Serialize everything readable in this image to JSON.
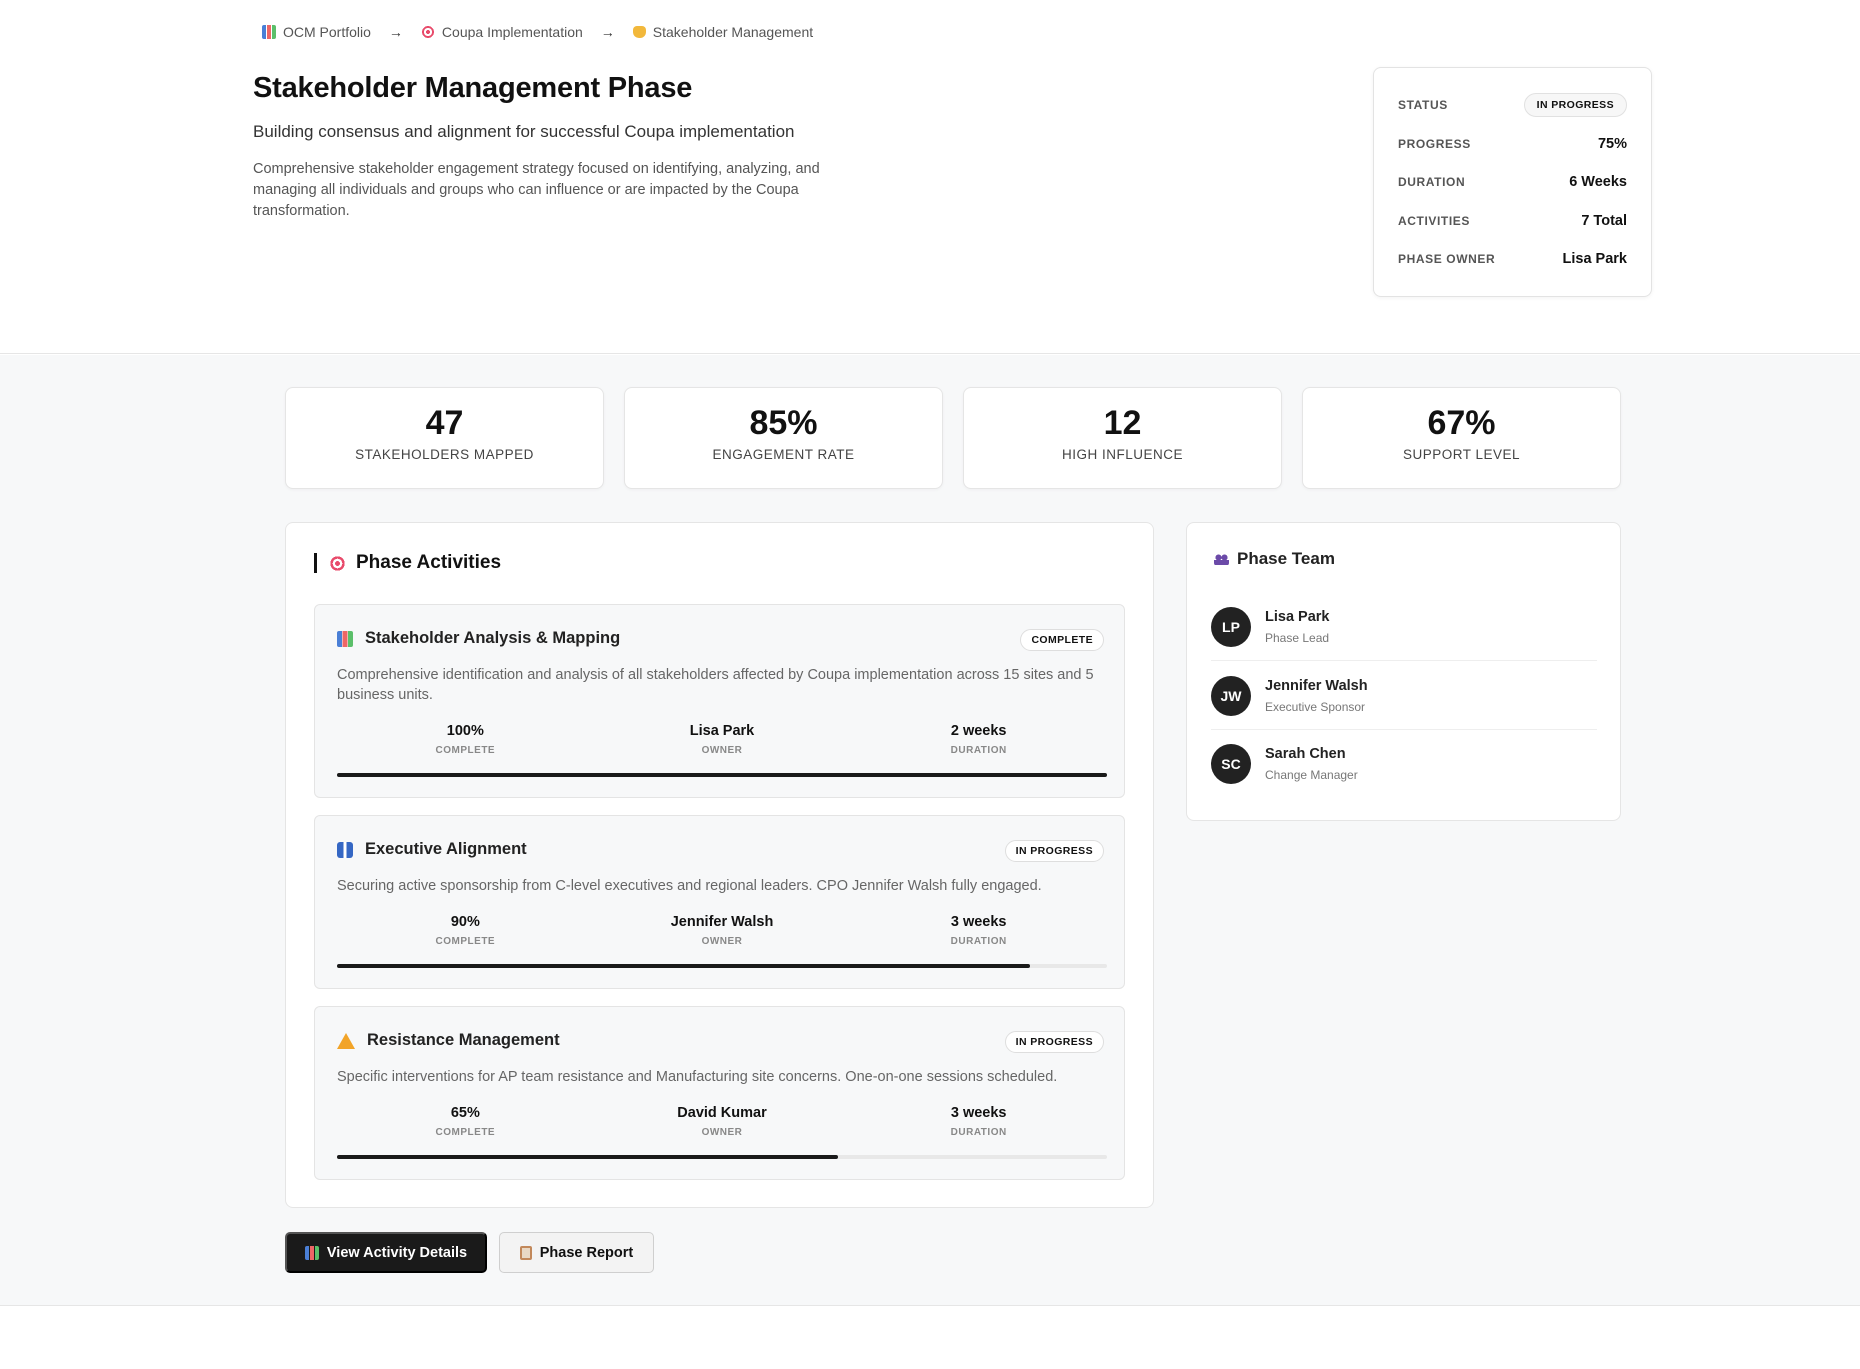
{
  "breadcrumb": [
    {
      "label": "OCM Portfolio"
    },
    {
      "label": "Coupa Implementation"
    },
    {
      "label": "Stakeholder Management"
    }
  ],
  "breadcrumb_separator": "→",
  "page": {
    "title": "Stakeholder Management Phase",
    "subtitle": "Building consensus and alignment for successful Coupa implementation",
    "description": "Comprehensive stakeholder engagement strategy focused on identifying, analyzing, and managing all individuals and groups who can influence or are impacted by the Coupa transformation."
  },
  "status_card": {
    "status_label": "STATUS",
    "status_value": "IN PROGRESS",
    "progress_label": "PROGRESS",
    "progress_value": "75%",
    "duration_label": "DURATION",
    "duration_value": "6 Weeks",
    "activities_label": "ACTIVITIES",
    "activities_value": "7 Total",
    "owner_label": "PHASE OWNER",
    "owner_value": "Lisa Park"
  },
  "stats": [
    {
      "value": "47",
      "label": "STAKEHOLDERS MAPPED"
    },
    {
      "value": "85%",
      "label": "ENGAGEMENT RATE"
    },
    {
      "value": "12",
      "label": "HIGH INFLUENCE"
    },
    {
      "value": "67%",
      "label": "SUPPORT LEVEL"
    }
  ],
  "activities_section": {
    "title": "Phase Activities",
    "metric_labels": {
      "complete": "COMPLETE",
      "owner": "OWNER",
      "duration": "DURATION"
    },
    "items": [
      {
        "icon": "chart-icon",
        "title": "Stakeholder Analysis & Mapping",
        "badge": "COMPLETE",
        "description": "Comprehensive identification and analysis of all stakeholders affected by Coupa implementation across 15 sites and 5 business units.",
        "complete": "100%",
        "owner": "Lisa Park",
        "duration": "2 weeks",
        "progress": 1.0
      },
      {
        "icon": "suit-icon",
        "title": "Executive Alignment",
        "badge": "IN PROGRESS",
        "description": "Securing active sponsorship from C-level executives and regional leaders. CPO Jennifer Walsh fully engaged.",
        "complete": "90%",
        "owner": "Jennifer Walsh",
        "duration": "3 weeks",
        "progress": 0.9
      },
      {
        "icon": "warning-icon",
        "title": "Resistance Management",
        "badge": "IN PROGRESS",
        "description": "Specific interventions for AP team resistance and Manufacturing site concerns. One-on-one sessions scheduled.",
        "complete": "65%",
        "owner": "David Kumar",
        "duration": "3 weeks",
        "progress": 0.65
      }
    ]
  },
  "team": {
    "title": "Phase Team",
    "members": [
      {
        "initials": "LP",
        "name": "Lisa Park",
        "role": "Phase Lead"
      },
      {
        "initials": "JW",
        "name": "Jennifer Walsh",
        "role": "Executive Sponsor"
      },
      {
        "initials": "SC",
        "name": "Sarah Chen",
        "role": "Change Manager"
      }
    ]
  },
  "actions": {
    "primary_label": "View Activity Details",
    "secondary_label": "Phase Report"
  },
  "colors": {
    "accent_dark": "#1a1a1a",
    "background_main": "#f7f8f9",
    "progress_track": "#e8e8e8"
  }
}
